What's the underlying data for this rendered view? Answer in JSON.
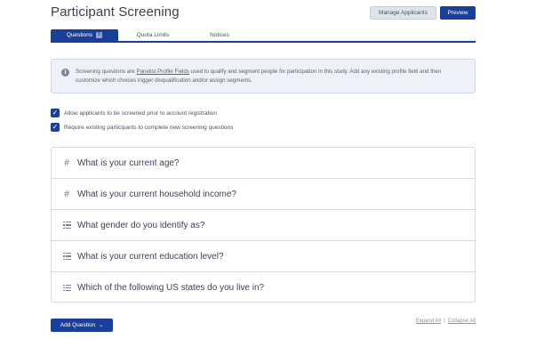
{
  "header": {
    "title": "Participant Screening",
    "manage_label": "Manage Applicants",
    "preview_label": "Preview"
  },
  "tabs": [
    {
      "label": "Questions",
      "count": "5",
      "active": true
    },
    {
      "label": "Quota Limits",
      "active": false
    },
    {
      "label": "Notices",
      "active": false
    }
  ],
  "info": {
    "icon": "info-icon",
    "text_before": "Screening questions are ",
    "link": "Panelist Profile Fields",
    "text_after": " used to qualify and segment people for participation in this study. Add any existing profile field and then customize which choices trigger disqualification and/or assign segments."
  },
  "options": [
    {
      "label": "Allow applicants to be screened prior to account registration",
      "checked": true
    },
    {
      "label": "Require existing participants to complete new screening questions",
      "checked": true
    }
  ],
  "questions": [
    {
      "icon": "hash-icon",
      "text": "What is your current age?"
    },
    {
      "icon": "hash-icon",
      "text": "What is your current household income?"
    },
    {
      "icon": "list-icon",
      "text": "What gender do you identify as?"
    },
    {
      "icon": "list-icon",
      "text": "What is your current education level?"
    },
    {
      "icon": "list-icon",
      "text": "Which of the following US states do you live in?"
    }
  ],
  "footer": {
    "add_label": "Add Question",
    "expand_label": "Expand All",
    "collapse_label": "Collapse All"
  },
  "colors": {
    "primary": "#1a3f9a",
    "info_bg": "#eef1f8"
  }
}
